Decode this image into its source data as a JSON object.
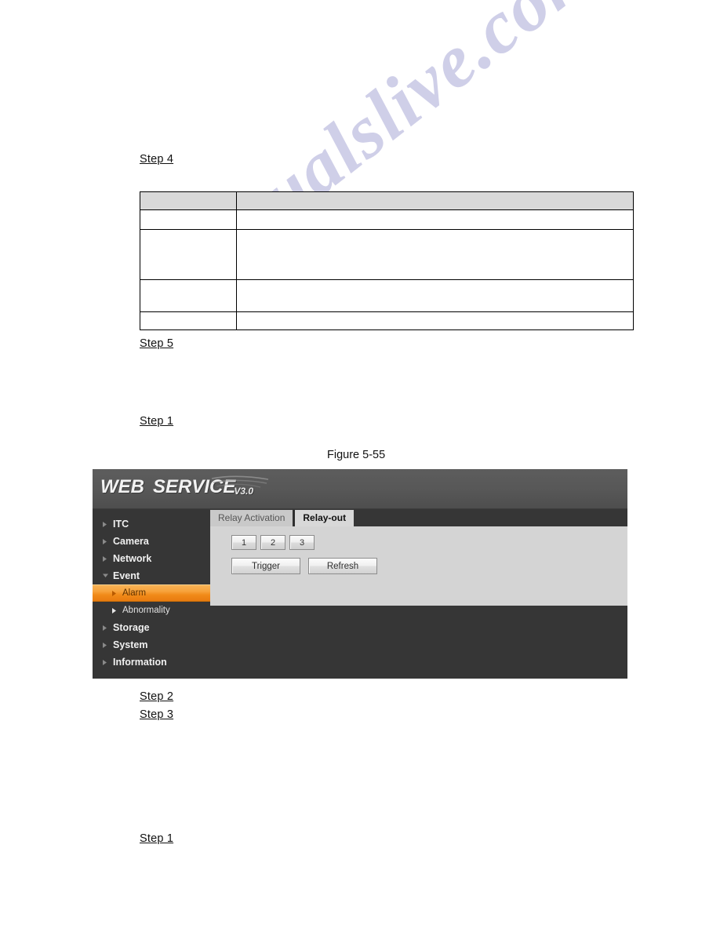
{
  "document": {
    "steps": [
      {
        "id": "step-4-top",
        "text": "Step 4"
      },
      {
        "id": "step-5",
        "text": "Step 5"
      },
      {
        "id": "step-1-upper",
        "text": "Step 1"
      },
      {
        "id": "step-2",
        "text": "Step 2"
      },
      {
        "id": "step-3",
        "text": "Step 3"
      },
      {
        "id": "step-1-lower",
        "text": "Step 1"
      }
    ],
    "figure_caption": "Figure 5-55",
    "watermark": "manualslive.com",
    "spec_table": {
      "header": [
        "",
        ""
      ],
      "rows": [
        [
          "",
          ""
        ],
        [
          "",
          ""
        ],
        [
          "",
          ""
        ],
        [
          "",
          ""
        ]
      ]
    }
  },
  "device_ui": {
    "brand": {
      "word1": "WEB",
      "word2": "SERVICE",
      "version": "V3.0"
    },
    "sidebar": {
      "items": [
        {
          "label": "ITC",
          "type": "top",
          "icon": "chevron-right-icon",
          "active": false
        },
        {
          "label": "Camera",
          "type": "top",
          "icon": "chevron-right-icon",
          "active": false
        },
        {
          "label": "Network",
          "type": "top",
          "icon": "chevron-right-icon",
          "active": false
        },
        {
          "label": "Event",
          "type": "top",
          "icon": "chevron-down-icon",
          "active": false
        },
        {
          "label": "Alarm",
          "type": "sub",
          "icon": "chevron-right-icon",
          "active": true
        },
        {
          "label": "Abnormality",
          "type": "sub",
          "icon": "chevron-right-icon",
          "active": false
        },
        {
          "label": "Storage",
          "type": "top",
          "icon": "chevron-right-icon",
          "active": false
        },
        {
          "label": "System",
          "type": "top",
          "icon": "chevron-right-icon",
          "active": false
        },
        {
          "label": "Information",
          "type": "top",
          "icon": "chevron-right-icon",
          "active": false
        }
      ]
    },
    "tabs": [
      {
        "label": "Relay Activation",
        "active": false
      },
      {
        "label": "Relay-out",
        "active": true
      }
    ],
    "relay_channels": [
      "1",
      "2",
      "3"
    ],
    "actions": [
      {
        "label": "Trigger"
      },
      {
        "label": "Refresh"
      }
    ],
    "colors": {
      "accent_orange": "#f18a18",
      "header_gray": "#575757",
      "sidebar_dark": "#363636",
      "panel_gray": "#d4d4d4"
    }
  }
}
